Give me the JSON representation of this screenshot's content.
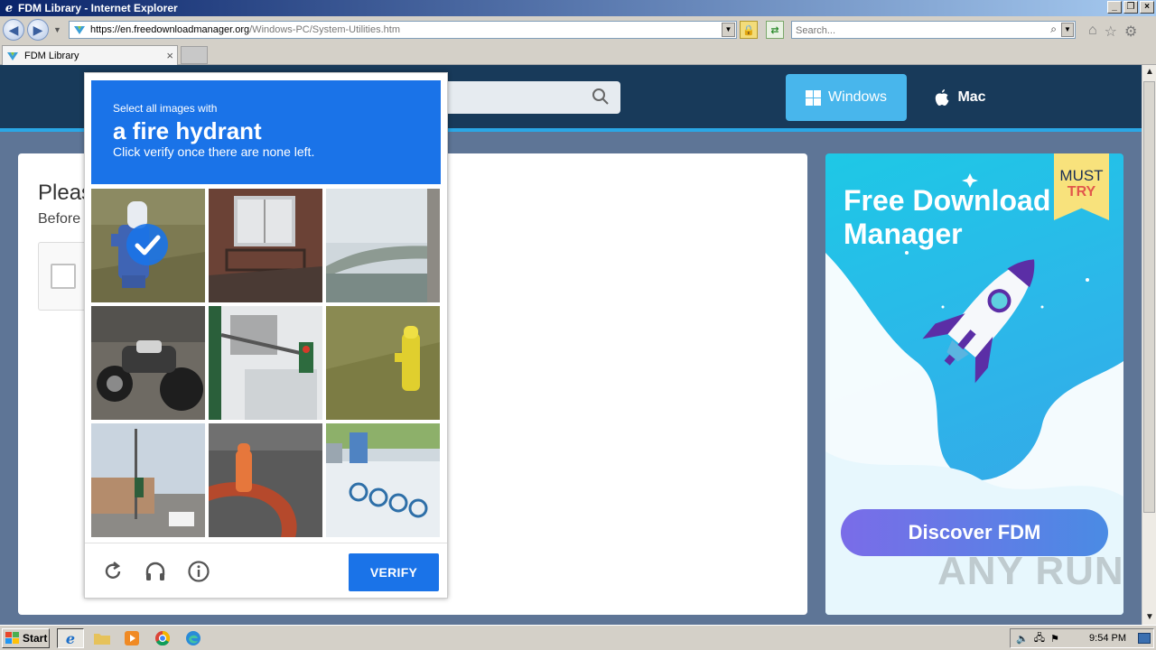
{
  "window": {
    "title": "FDM Library - Internet Explorer",
    "buttons": [
      "minimize",
      "restore",
      "close"
    ]
  },
  "addressbar": {
    "url_host": "https://en.freedownloadmanager.org",
    "url_path": "/Windows-PC/System-Utilities.htm",
    "search_placeholder": "Search..."
  },
  "tabs": [
    {
      "label": "FDM Library",
      "active": true
    }
  ],
  "site": {
    "os_windows_label": "Windows",
    "os_mac_label": "Mac",
    "please_text": "Pleas",
    "before_text": "Before",
    "ad": {
      "title": "Free Download Manager",
      "badge_line1": "MUST",
      "badge_line2": "TRY",
      "button_label": "Discover FDM"
    }
  },
  "captcha": {
    "instruction_small": "Select all images with",
    "target_object": "a fire hydrant",
    "instruction_hint": "Click verify once there are none left.",
    "tiles": [
      {
        "index": 0,
        "subject": "blue fire hydrant",
        "selected": true
      },
      {
        "index": 1,
        "subject": "window with balcony",
        "selected": false
      },
      {
        "index": 2,
        "subject": "bridge structure",
        "selected": false
      },
      {
        "index": 3,
        "subject": "motorcycle",
        "selected": false
      },
      {
        "index": 4,
        "subject": "traffic light and sign",
        "selected": false
      },
      {
        "index": 5,
        "subject": "yellow fire hydrant",
        "selected": false
      },
      {
        "index": 6,
        "subject": "street intersection",
        "selected": false
      },
      {
        "index": 7,
        "subject": "orange fire hydrant",
        "selected": false
      },
      {
        "index": 8,
        "subject": "bicycles",
        "selected": false
      }
    ],
    "verify_label": "VERIFY"
  },
  "watermark": "ANY RUN",
  "taskbar": {
    "start_label": "Start",
    "apps": [
      "internet-explorer",
      "file-explorer",
      "media-player",
      "chrome",
      "edge"
    ],
    "clock": "9:54 PM"
  },
  "colors": {
    "captcha_blue": "#1a73e8",
    "site_header": "#183a5a",
    "site_accent": "#2aa7e6",
    "windows_button": "#48b6ec"
  }
}
